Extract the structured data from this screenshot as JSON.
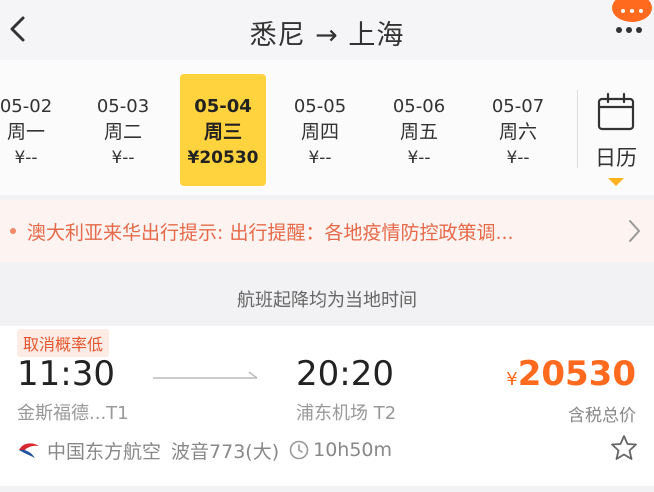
{
  "header": {
    "title": "悉尼 → 上海"
  },
  "dates": [
    {
      "date": "05-02",
      "weekday": "周一",
      "price": "¥--"
    },
    {
      "date": "05-03",
      "weekday": "周二",
      "price": "¥--"
    },
    {
      "date": "05-04",
      "weekday": "周三",
      "price": "¥20530",
      "selected": true
    },
    {
      "date": "05-05",
      "weekday": "周四",
      "price": "¥--"
    },
    {
      "date": "05-06",
      "weekday": "周五",
      "price": "¥--"
    },
    {
      "date": "05-07",
      "weekday": "周六",
      "price": "¥--"
    }
  ],
  "calendar": {
    "label": "日历"
  },
  "notice": {
    "text": "澳大利亚来华出行提示: 出行提醒：各地疫情防控政策调..."
  },
  "timezone_note": "航班起降均为当地时间",
  "flight": {
    "badge": "取消概率低",
    "dep_time": "11:30",
    "arr_time": "20:20",
    "dep_airport": "金斯福德...T1",
    "arr_airport": "浦东机场 T2",
    "currency": "¥",
    "price": "20530",
    "price_note": "含税总价",
    "airline": "中国东方航空",
    "aircraft": "波音773(大)",
    "duration": "10h50m"
  },
  "colors": {
    "accent": "#ff6a1f",
    "selected": "#ffd33d",
    "notice_bg": "#fdf3f1",
    "notice_text": "#e56a49"
  }
}
